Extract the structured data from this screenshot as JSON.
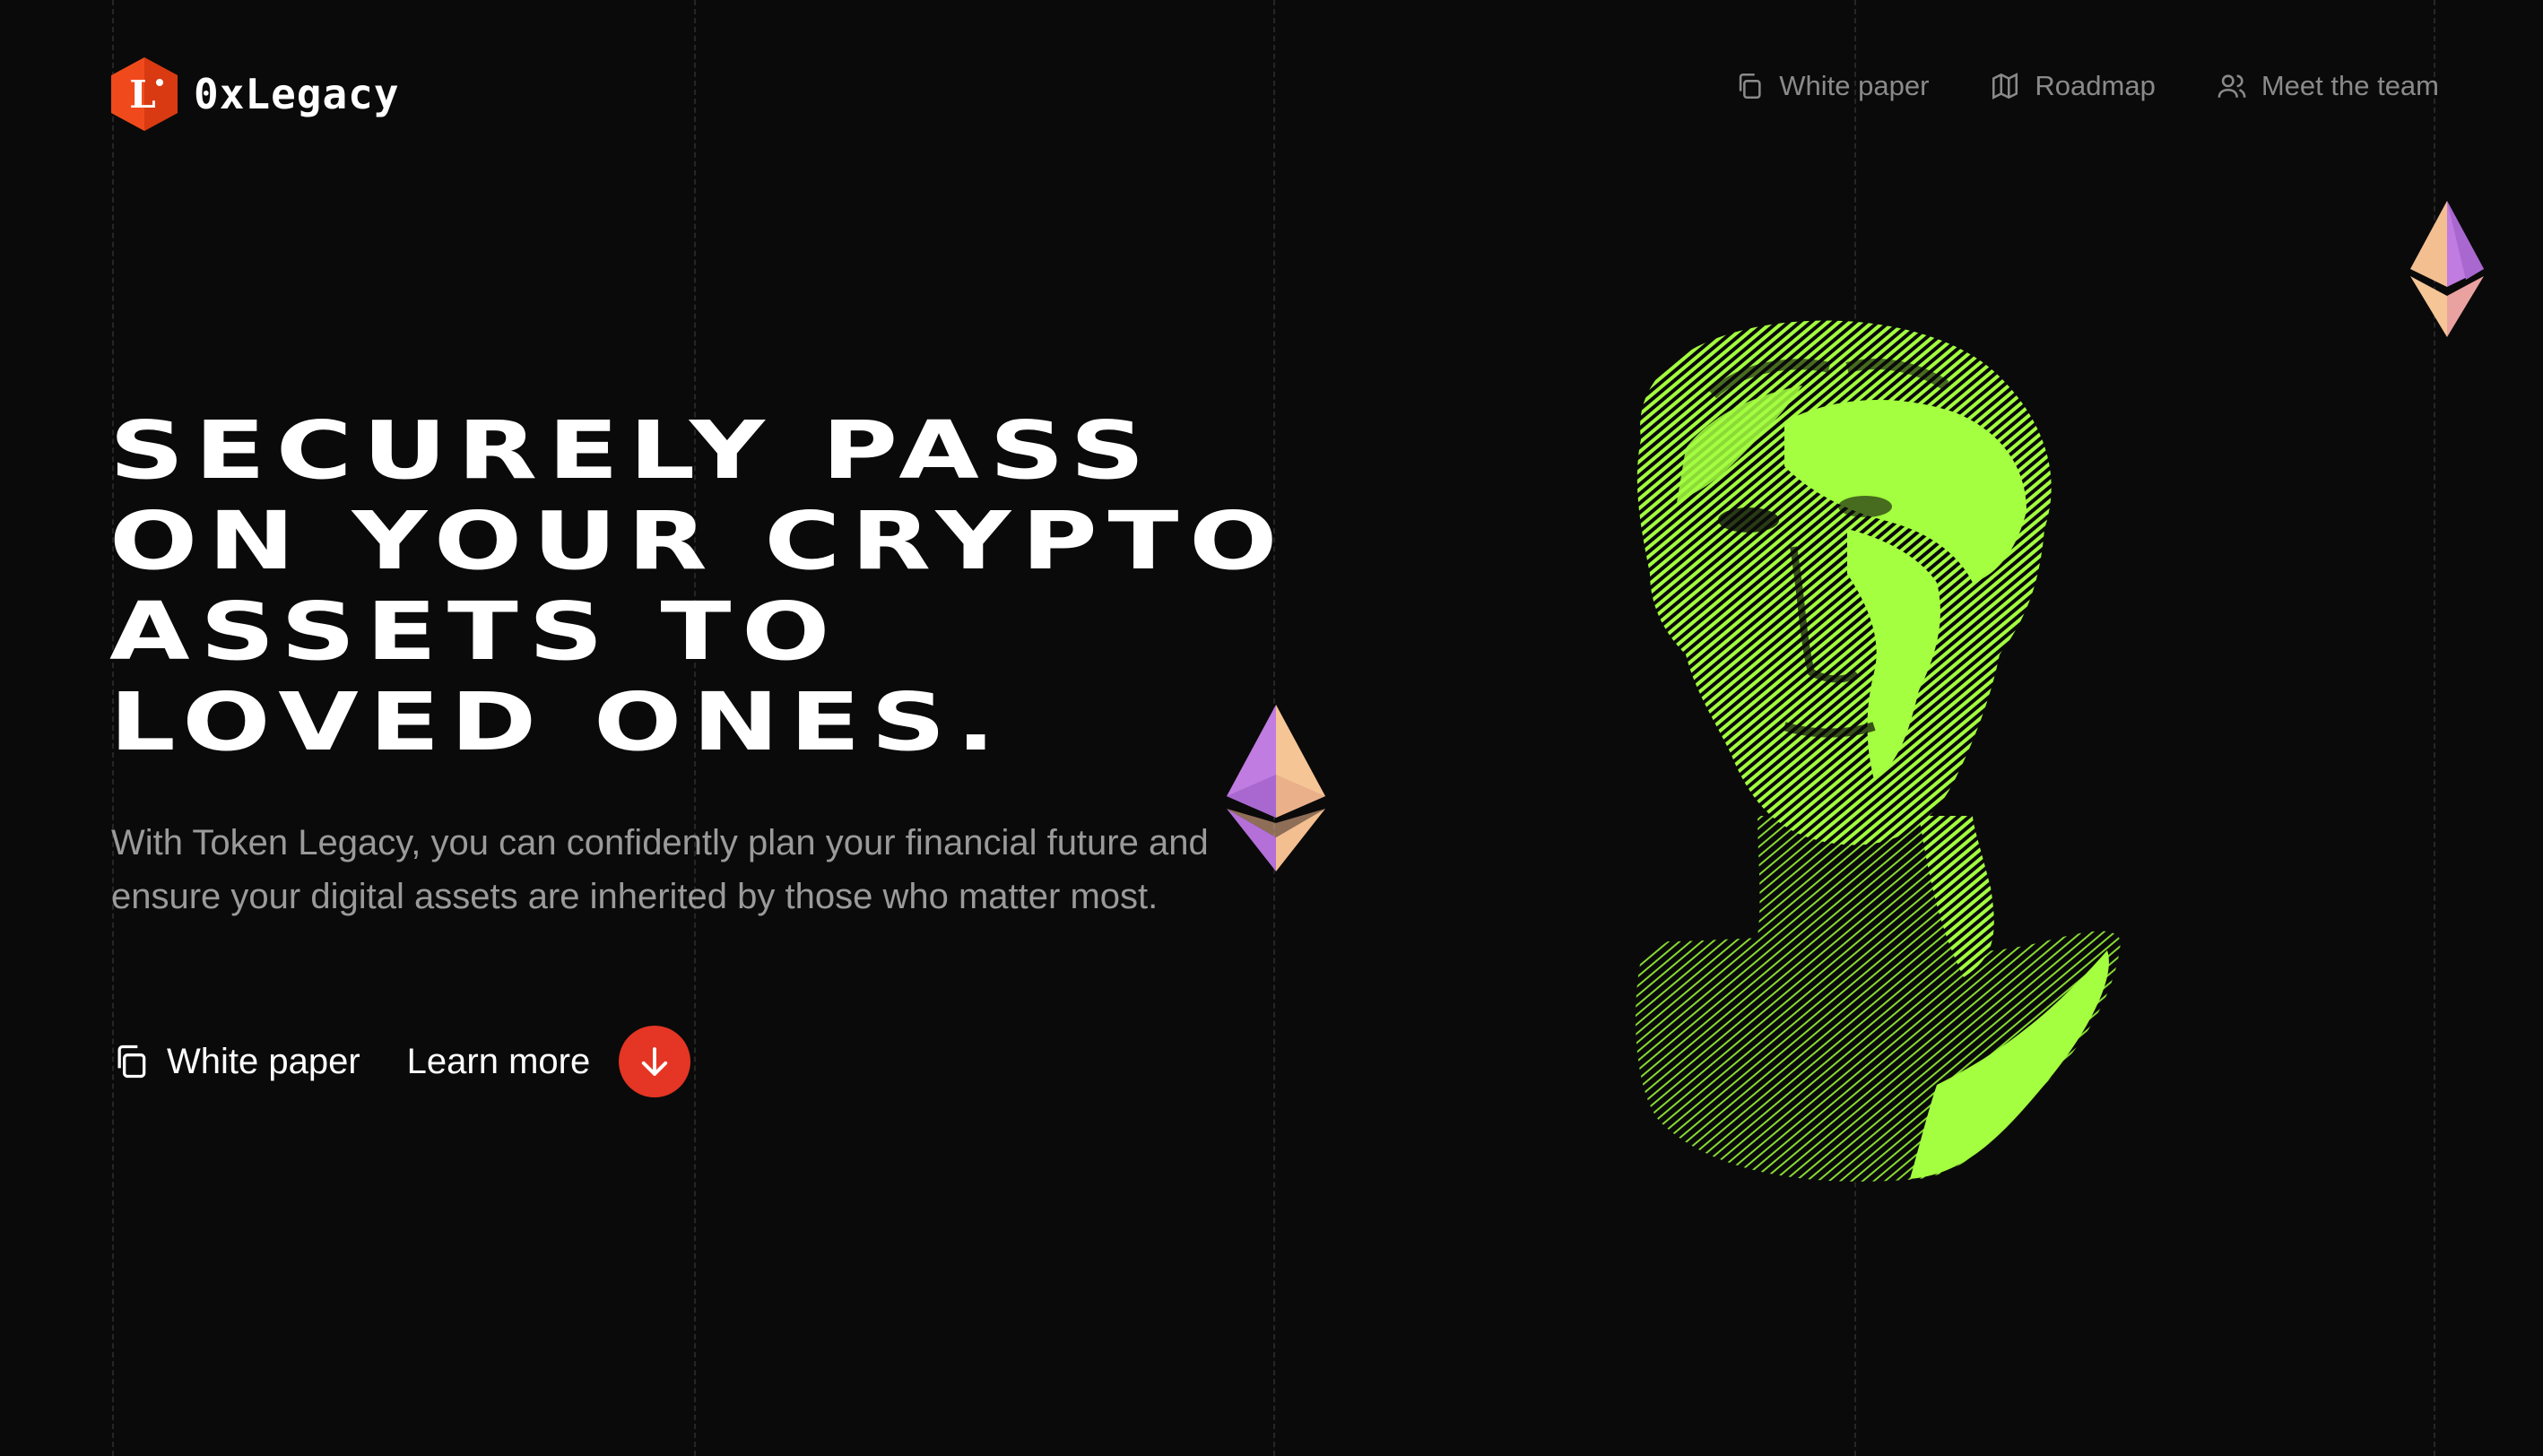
{
  "logo": {
    "text": "0xLegacy",
    "mark_letter": "L"
  },
  "nav": {
    "items": [
      {
        "label": "White paper",
        "icon": "copy-icon"
      },
      {
        "label": "Roadmap",
        "icon": "map-icon"
      },
      {
        "label": "Meet the team",
        "icon": "users-icon"
      }
    ]
  },
  "hero": {
    "title_lines": [
      "SECURELY PASS",
      "ON YOUR CRYPTO",
      "ASSETS TO",
      "LOVED ONES."
    ],
    "subtitle": "With Token Legacy, you can confidently plan your financial future and ensure your digital assets are inherited by those who matter most.",
    "white_paper_label": "White paper",
    "learn_more_label": "Learn more"
  },
  "colors": {
    "background": "#0a0a0a",
    "accent_red": "#e53524",
    "logo_orange": "#f04a1c",
    "bust_green": "#a3ff3f",
    "eth_purple": "#c07ce0",
    "eth_peach": "#f5c596"
  }
}
